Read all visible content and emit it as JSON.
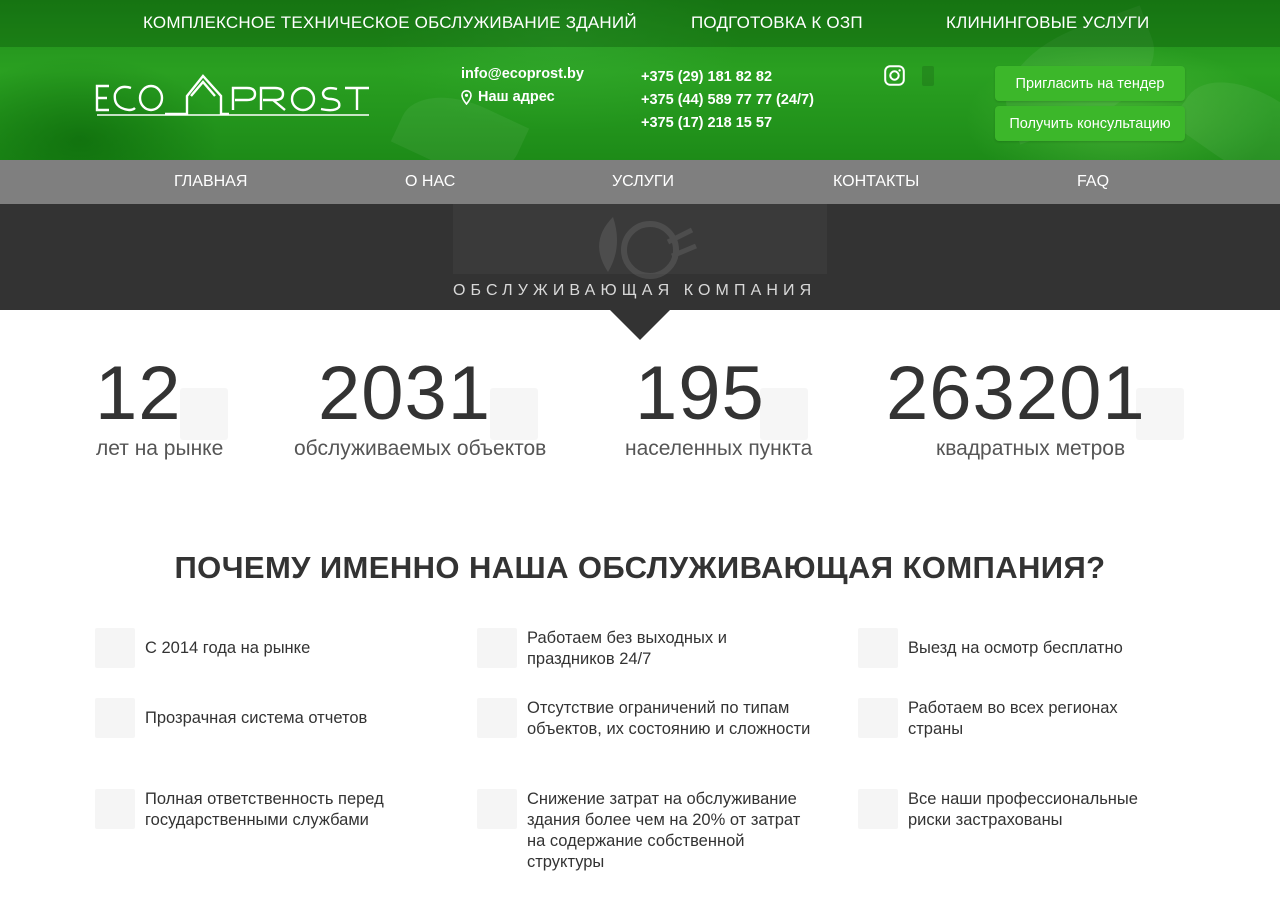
{
  "top_links": [
    "КОМПЛЕКСНОЕ ТЕХНИЧЕСКОЕ ОБСЛУЖИВАНИЕ ЗДАНИЙ",
    "ПОДГОТОВКА К ОЗП",
    "КЛИНИНГОВЫЕ УСЛУГИ"
  ],
  "logo": {
    "text_left": "ECO",
    "text_right": "PROST"
  },
  "contacts": {
    "email": "info@ecoprost.by",
    "address": "Наш адрес",
    "phones": [
      "+375 (29) 181 82 82",
      "+375 (44) 589 77 77 (24/7)",
      "+375 (17) 218 15 57"
    ]
  },
  "social": {
    "instagram": "instagram-icon"
  },
  "buttons": {
    "tender": "Пригласить на тендер",
    "consult": "Получить консультацию"
  },
  "nav": [
    "ГЛАВНАЯ",
    "О НАС",
    "УСЛУГИ",
    "КОНТАКТЫ",
    "FAQ"
  ],
  "band": {
    "caption": "ОБСЛУЖИВАЮЩАЯ КОМПАНИЯ"
  },
  "stats": [
    {
      "number": "12",
      "label": "лет на рынке"
    },
    {
      "number": "2031",
      "label": "обслуживаемых объектов"
    },
    {
      "number": "195",
      "label": "населенных пункта"
    },
    {
      "number": "263201",
      "label": "квадратных метров"
    }
  ],
  "why": {
    "title": "ПОЧЕМУ ИМЕННО НАША ОБСЛУЖИВАЮЩАЯ КОМПАНИЯ?",
    "features": [
      "С 2014 года на рынке",
      "Работаем без выходных и праздников 24/7",
      "Выезд на осмотр бесплатно",
      "Прозрачная система отчетов",
      "Отсутствие ограничений по типам объектов, их состоянию и сложности",
      "Работаем во всех регионах страны",
      "Полная ответственность перед государственными службами",
      "Снижение затрат на обслуживание здания более чем на 20% от затрат на содержание собственной структуры",
      "Все наши профессиональные риски застрахованы"
    ]
  },
  "colors": {
    "green": "#2aa021",
    "button": "#3cb72a",
    "nav": "#7f7f7f",
    "band": "#333333"
  }
}
